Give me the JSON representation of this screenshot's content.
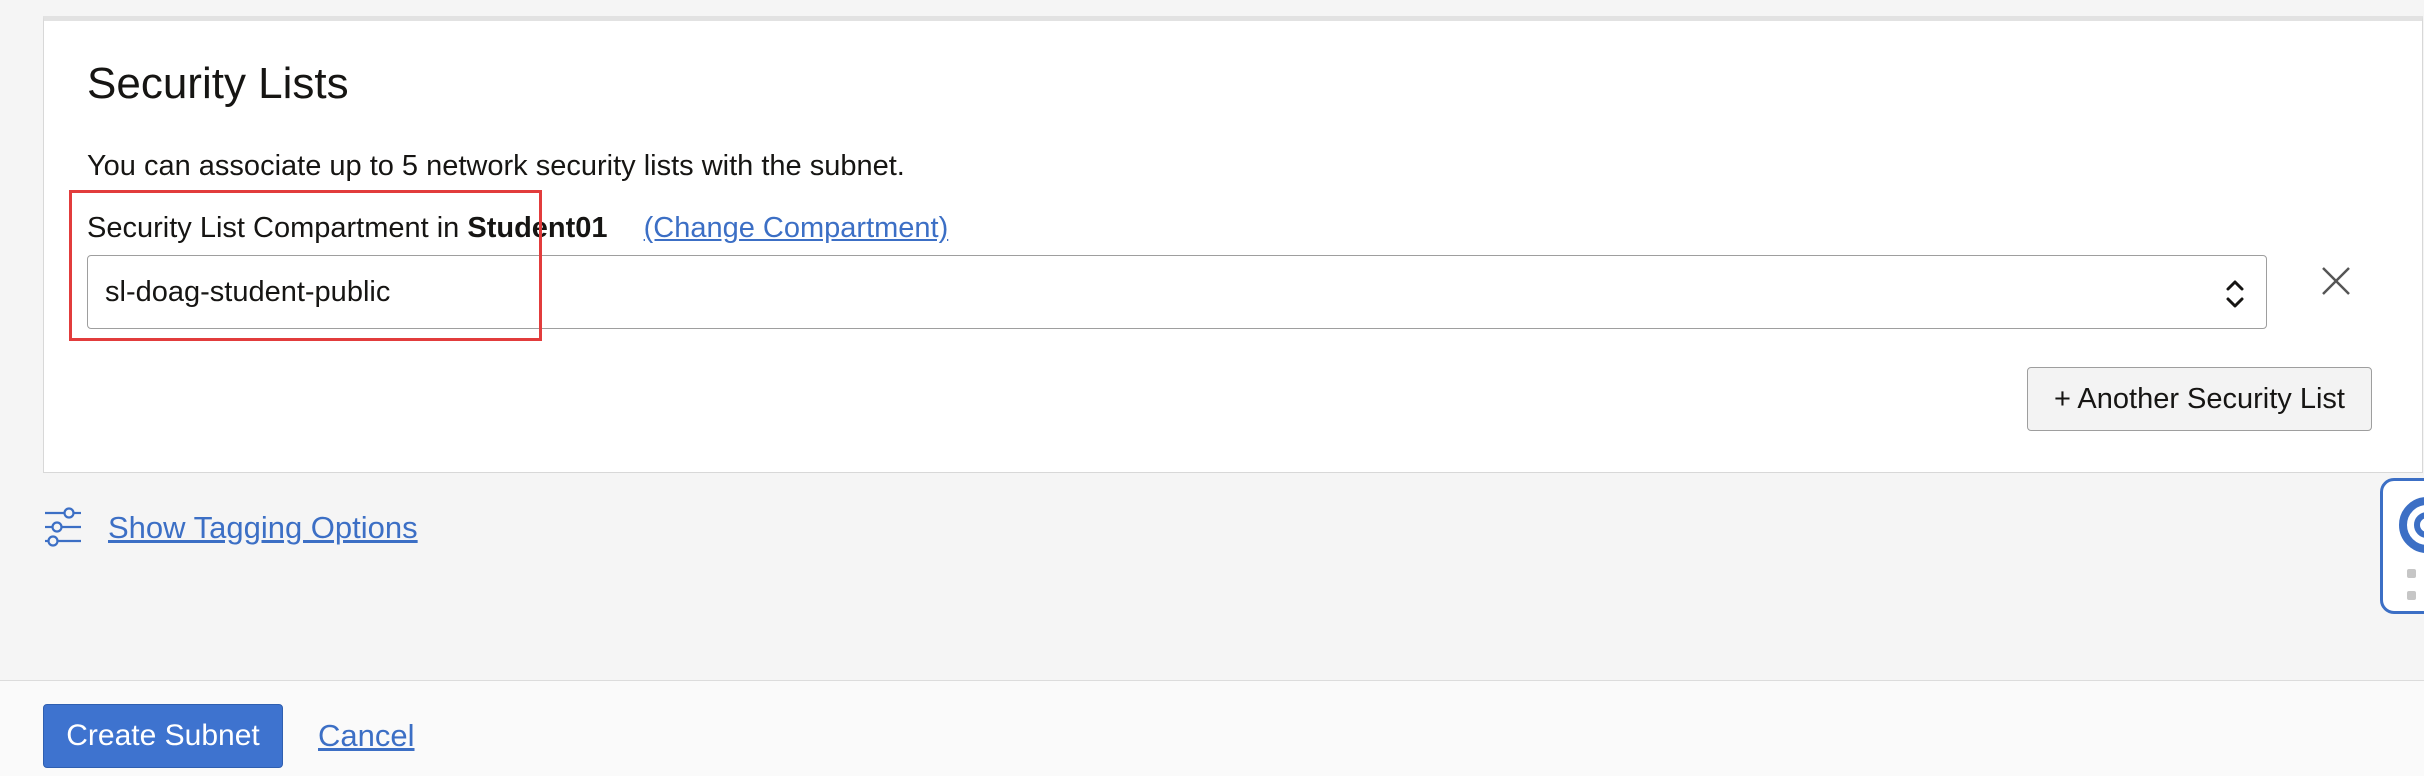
{
  "section": {
    "title": "Security Lists",
    "help_text": "You can associate up to 5 network security lists with the subnet."
  },
  "compartment": {
    "label_prefix": "Security List Compartment in",
    "name": "Student01",
    "change_link": "(Change Compartment)"
  },
  "security_list_select": {
    "value": "sl-doag-student-public"
  },
  "buttons": {
    "another_security_list": "+ Another Security List",
    "create_subnet": "Create Subnet",
    "cancel": "Cancel"
  },
  "tagging": {
    "link_label": "Show Tagging Options"
  },
  "icons": {
    "remove": "close-icon",
    "select_arrows": "chevron-up-down-icon",
    "tagging": "sliders-icon",
    "help": "life-ring-icon"
  },
  "colors": {
    "link": "#3c6fc5",
    "primary_button": "#3e73cf",
    "highlight": "#e23c3c"
  }
}
